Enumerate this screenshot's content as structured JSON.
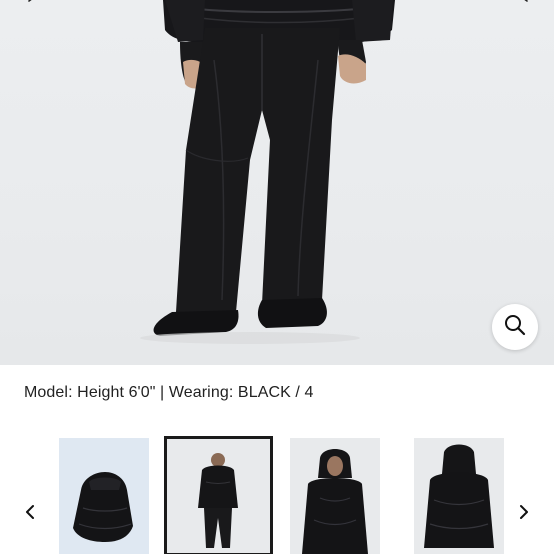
{
  "gallery": {
    "caption": "Model: Height 6'0\" | Wearing: BLACK / 4"
  },
  "icons": {
    "prev": "chevron-left-icon",
    "next": "chevron-right-icon",
    "zoom": "search-icon"
  },
  "thumbnails": {
    "selected_index": 1,
    "count": 5
  },
  "colors": {
    "background": "#e9ebed",
    "garment": "#1a1a1c",
    "accent": "#111111"
  }
}
